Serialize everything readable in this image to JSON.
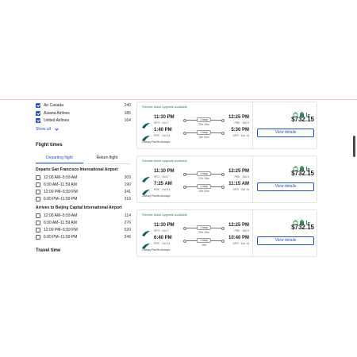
{
  "airlines": [
    {
      "label": "Air Canada",
      "count": "240",
      "checked": true
    },
    {
      "label": "Asiana Airlines",
      "count": "185",
      "checked": true
    },
    {
      "label": "United Airlines",
      "count": "164",
      "checked": true
    }
  ],
  "show_all_label": "Show all",
  "flight_times": {
    "title": "Flight times",
    "tabs": [
      "Departing flight",
      "Return flight"
    ],
    "departs_title": "Departs San Francisco International Airport",
    "departs": [
      {
        "label": "12:00 AM–5:59 AM",
        "count": "309"
      },
      {
        "label": "6:00 AM–11:59 AM",
        "count": "190"
      },
      {
        "label": "12:00 PM–5:59 PM",
        "count": "341"
      },
      {
        "label": "6:00 PM–11:59 PM",
        "count": "316"
      }
    ],
    "arrives_title": "Arrives to Beijing Capital International Airport",
    "arrives": [
      {
        "label": "12:00 AM–5:59 AM",
        "count": "114"
      },
      {
        "label": "6:00 AM–11:59 AM",
        "count": "276"
      },
      {
        "label": "12:00 PM–5:59 PM",
        "count": "520"
      },
      {
        "label": "6:00 PM–11:59 PM",
        "count": "246"
      }
    ]
  },
  "travel_time_title": "Travel time",
  "results": [
    {
      "upgrade": "Flexible ticket upgrade available",
      "outbound": {
        "dep": "11:10 PM",
        "dep_sub": "SFO · Oct 7",
        "stops": "1 stop",
        "dur": "22h 15m",
        "arr": "12:25 PM",
        "arr_sub": "PEK · Oct 9"
      },
      "inbound": {
        "dep": "1:40 PM",
        "dep_sub": "PEK · Oct 14",
        "stops": "1 stop",
        "dur": "18h 50m",
        "arr": "5:30 PM",
        "arr_sub": "SFO · Oct 14"
      },
      "carrier": "Cathay Pacific Airways",
      "price": "$732.15",
      "button": "View details"
    },
    {
      "upgrade": "Flexible ticket upgrade available",
      "outbound": {
        "dep": "11:10 PM",
        "dep_sub": "SFO · Oct 7",
        "stops": "1 stop",
        "dur": "22h 15m",
        "arr": "12:25 PM",
        "arr_sub": "PEK · Oct 9"
      },
      "inbound": {
        "dep": "7:25 AM",
        "dep_sub": "PEK · Oct 14",
        "stops": "1 stop",
        "dur": "18h 50m",
        "arr": "11:15 AM",
        "arr_sub": "SFO · Oct 14"
      },
      "carrier": "Cathay Pacific Airways",
      "price": "$732.15",
      "button": "View details"
    },
    {
      "upgrade": "Flexible ticket upgrade available",
      "outbound": {
        "dep": "11:10 PM",
        "dep_sub": "SFO · Oct 7",
        "stops": "1 stop",
        "dur": "22h 15m",
        "arr": "12:25 PM",
        "arr_sub": "PEK · Oct 9"
      },
      "inbound": {
        "dep": "6:40 PM",
        "dep_sub": "PEK · Oct 14",
        "stops": "1 stop",
        "dur": "18h",
        "arr": "10:40 PM",
        "arr_sub": "SFO · Oct 14"
      },
      "carrier": "Cathay Pacific Airways",
      "price": "$732.15",
      "button": "View details"
    }
  ],
  "icons": {
    "airline_logo": "cathay-pacific-logo-icon",
    "amenities": [
      "carry-on-bag-icon",
      "checked-bag-icon",
      "seat-icon"
    ]
  },
  "colors": {
    "accent": "#1a57c9",
    "upgrade_green": "#1e8a3c",
    "logo_green": "#006564",
    "amenity_green": "#2e8b57"
  }
}
